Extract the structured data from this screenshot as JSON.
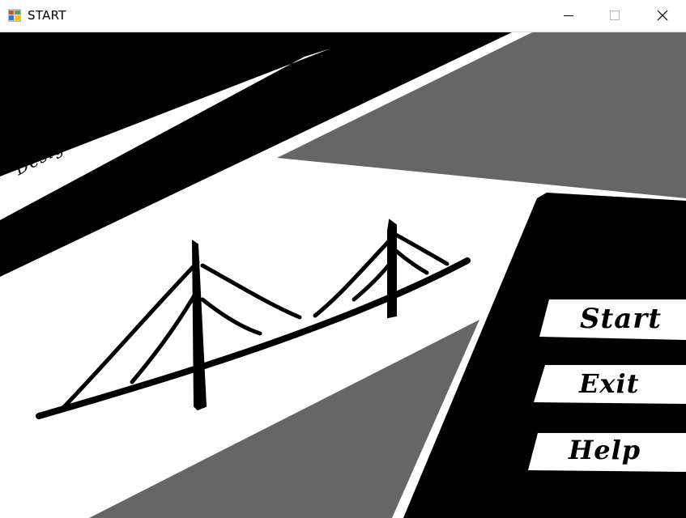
{
  "window": {
    "title": "START",
    "app_icon": "windows-forms-app-icon",
    "controls": {
      "minimize_icon": "minimize-icon",
      "maximize_icon": "maximize-icon",
      "close_icon": "close-icon"
    }
  },
  "banner": {
    "text": "Design of Cable Stayed Bridge"
  },
  "illustration": {
    "icon": "cable-stayed-bridge-drawing"
  },
  "menu": {
    "start_label": "Start",
    "exit_label": "Exit",
    "help_label": "Help"
  },
  "colors": {
    "black": "#000000",
    "gray": "#666666",
    "white": "#ffffff"
  }
}
